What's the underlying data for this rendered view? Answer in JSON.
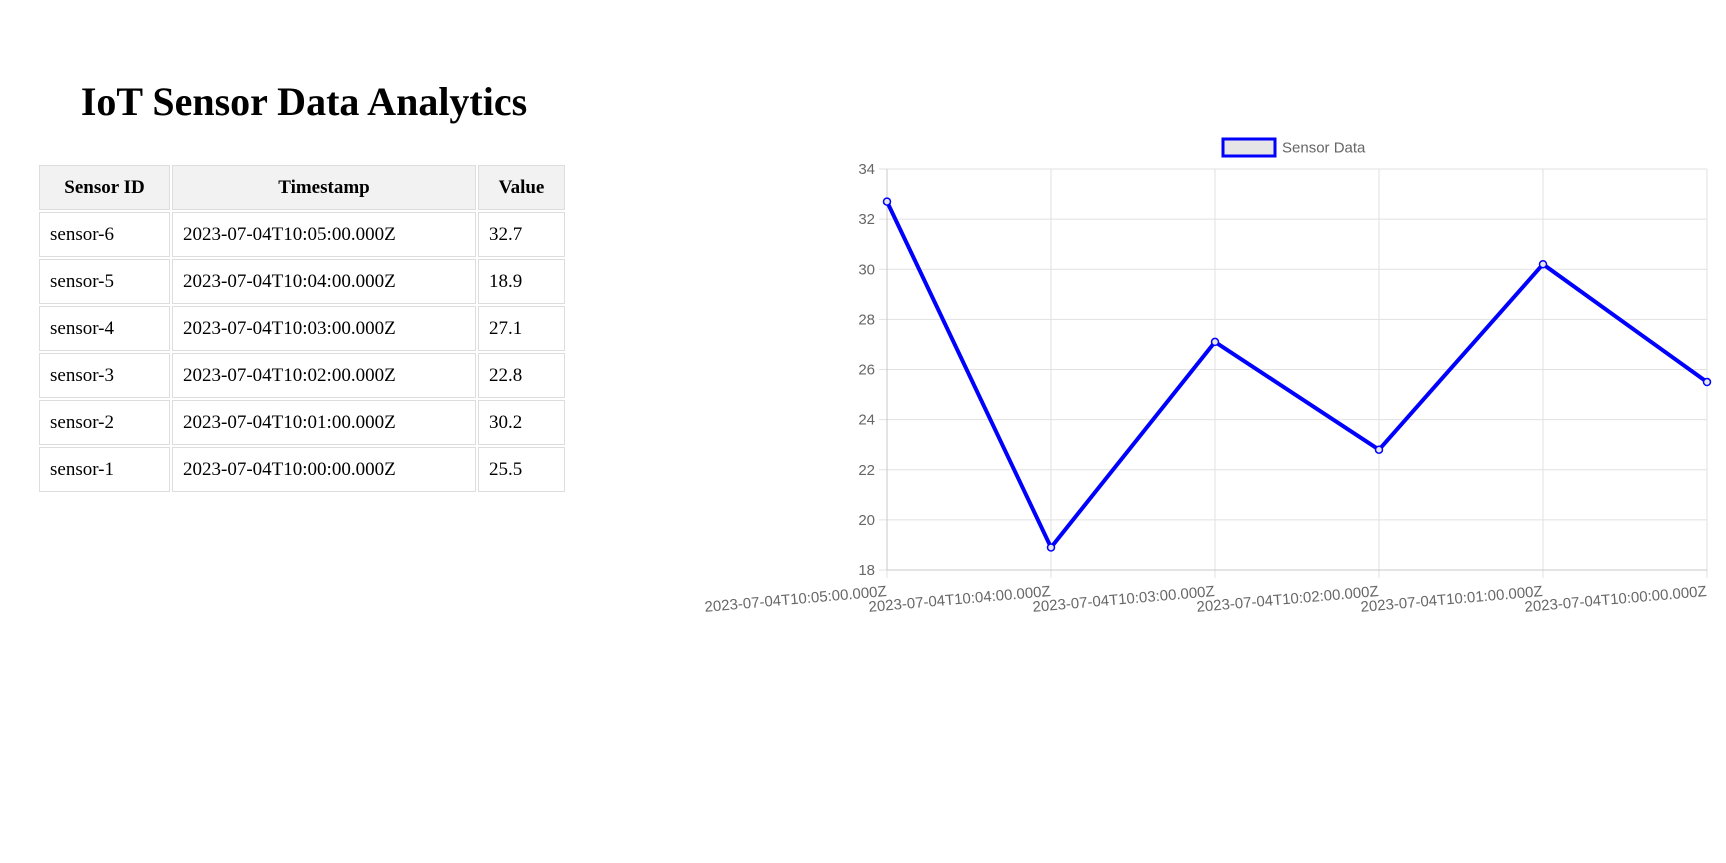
{
  "page": {
    "title": "IoT Sensor Data Analytics"
  },
  "table": {
    "headers": [
      "Sensor ID",
      "Timestamp",
      "Value"
    ],
    "rows": [
      [
        "sensor-6",
        "2023-07-04T10:05:00.000Z",
        "32.7"
      ],
      [
        "sensor-5",
        "2023-07-04T10:04:00.000Z",
        "18.9"
      ],
      [
        "sensor-4",
        "2023-07-04T10:03:00.000Z",
        "27.1"
      ],
      [
        "sensor-3",
        "2023-07-04T10:02:00.000Z",
        "22.8"
      ],
      [
        "sensor-2",
        "2023-07-04T10:01:00.000Z",
        "30.2"
      ],
      [
        "sensor-1",
        "2023-07-04T10:00:00.000Z",
        "25.5"
      ]
    ]
  },
  "chart_data": {
    "type": "line",
    "categories": [
      "2023-07-04T10:05:00.000Z",
      "2023-07-04T10:04:00.000Z",
      "2023-07-04T10:03:00.000Z",
      "2023-07-04T10:02:00.000Z",
      "2023-07-04T10:01:00.000Z",
      "2023-07-04T10:00:00.000Z"
    ],
    "series": [
      {
        "name": "Sensor Data",
        "values": [
          32.7,
          18.9,
          27.1,
          22.8,
          30.2,
          25.5
        ],
        "color": "#0000ff",
        "fill": "#e6e6e6"
      }
    ],
    "yticks": [
      18,
      20,
      22,
      24,
      26,
      28,
      30,
      32,
      34
    ],
    "ylim": [
      18,
      34
    ],
    "grid": true,
    "legend": "top",
    "title": "",
    "xlabel": "",
    "ylabel": "",
    "colors": {
      "grid": "#e1e1e1",
      "tick_text": "#666666"
    }
  }
}
